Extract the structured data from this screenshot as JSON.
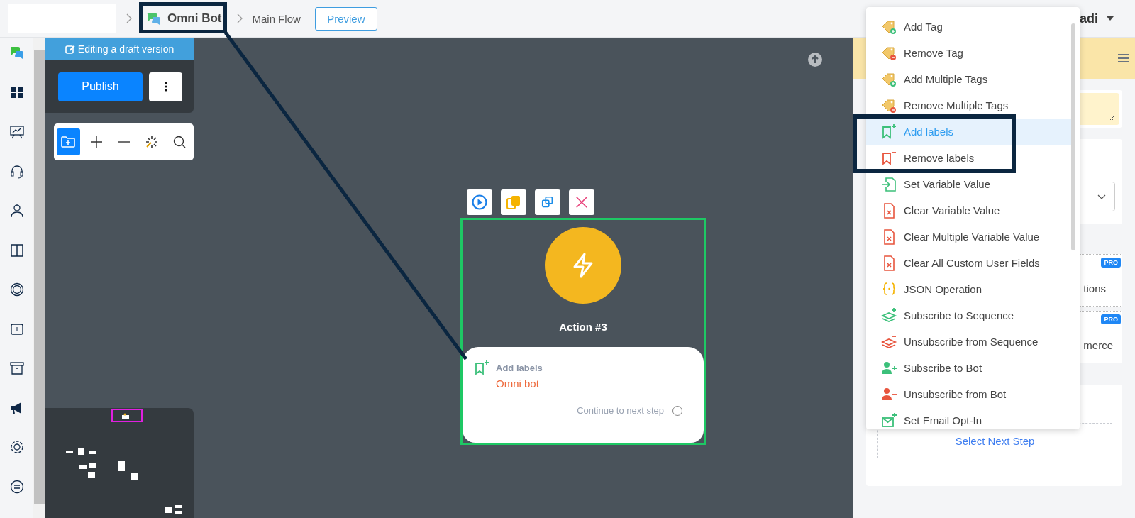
{
  "breadcrumb": {
    "bot": "Omni Bot",
    "flow": "Main Flow"
  },
  "preview_button": "Preview",
  "user": {
    "name": "adi"
  },
  "editor": {
    "banner": "Editing a draft version",
    "publish_button": "Publish"
  },
  "node": {
    "title": "Action #3",
    "action": "Add labels",
    "value": "Omni bot",
    "next": "Continue to next step"
  },
  "menu": {
    "items": [
      {
        "label": "Add Tag",
        "kind": "tag",
        "negative": false,
        "selected": false
      },
      {
        "label": "Remove Tag",
        "kind": "tag",
        "negative": true,
        "selected": false
      },
      {
        "label": "Add Multiple Tags",
        "kind": "tag",
        "negative": false,
        "selected": false
      },
      {
        "label": "Remove Multiple Tags",
        "kind": "tag",
        "negative": true,
        "selected": false
      },
      {
        "label": "Add labels",
        "kind": "label",
        "negative": false,
        "selected": true
      },
      {
        "label": "Remove labels",
        "kind": "label",
        "negative": true,
        "selected": false
      },
      {
        "label": "Set Variable Value",
        "kind": "variable",
        "negative": false,
        "selected": false
      },
      {
        "label": "Clear Variable Value",
        "kind": "clear",
        "negative": true,
        "selected": false
      },
      {
        "label": "Clear Multiple Variable Value",
        "kind": "clear",
        "negative": true,
        "selected": false
      },
      {
        "label": "Clear All Custom User Fields",
        "kind": "clear",
        "negative": true,
        "selected": false
      },
      {
        "label": "JSON Operation",
        "kind": "json",
        "selected": false
      },
      {
        "label": "Subscribe to Sequence",
        "kind": "sequence",
        "negative": false,
        "selected": false
      },
      {
        "label": "Unsubscribe from Sequence",
        "kind": "sequence",
        "negative": true,
        "selected": false
      },
      {
        "label": "Subscribe to Bot",
        "kind": "person",
        "negative": false,
        "selected": false
      },
      {
        "label": "Unsubscribe from Bot",
        "kind": "person",
        "negative": true,
        "selected": false
      },
      {
        "label": "Set Email Opt-In",
        "kind": "email",
        "negative": false,
        "selected": false
      }
    ]
  },
  "right_panel": {
    "cards": [
      {
        "text": "tions",
        "badge": "PRO"
      },
      {
        "text": "merce",
        "badge": "PRO"
      }
    ],
    "next_step": "Select Next Step"
  }
}
